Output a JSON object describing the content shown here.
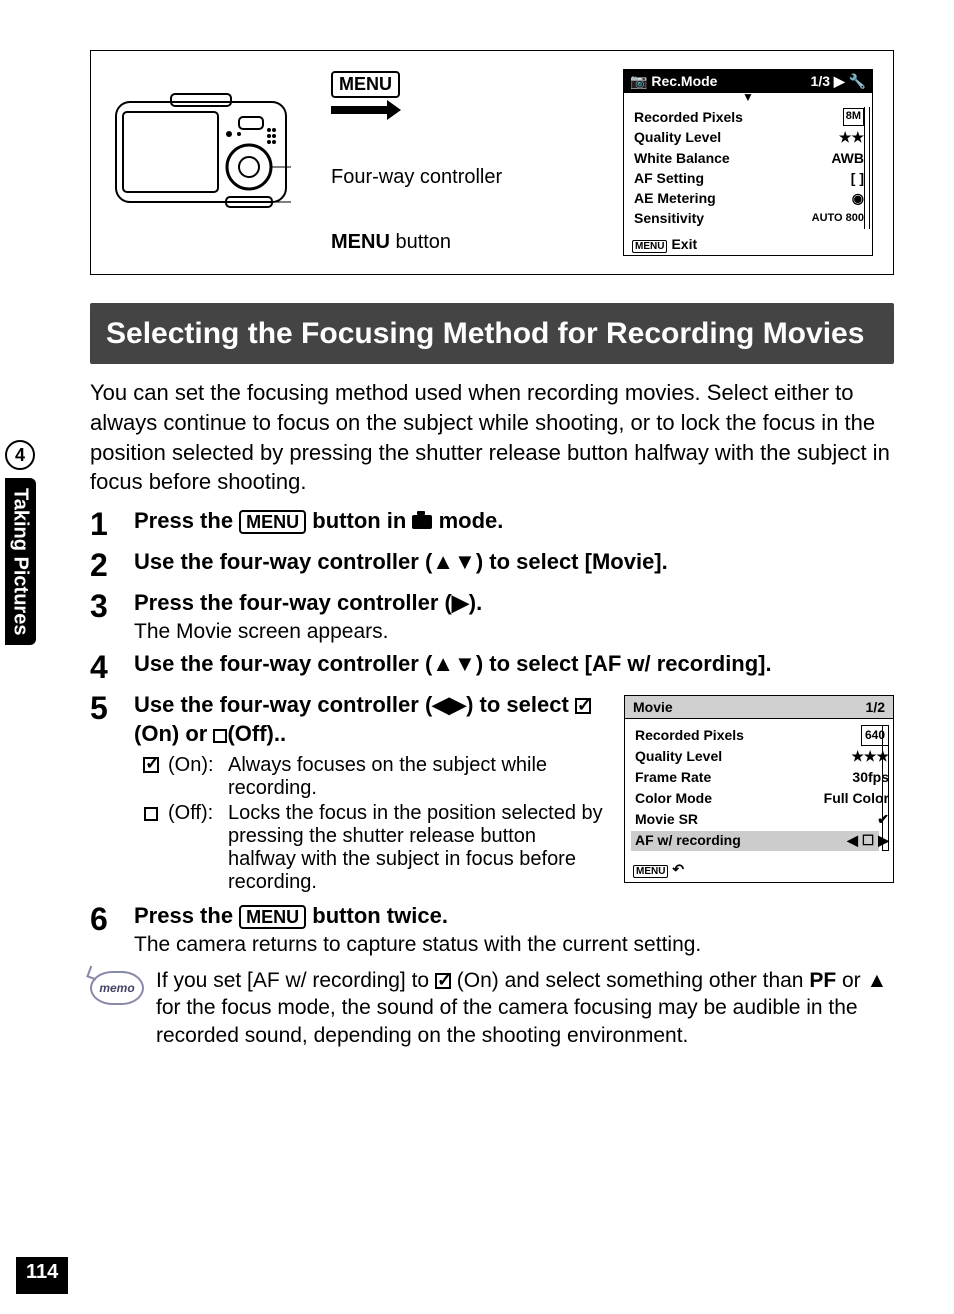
{
  "side": {
    "chapter_num": "4",
    "chapter_label": "Taking Pictures"
  },
  "page_number": "114",
  "figure": {
    "controller_label": "Four-way controller",
    "menu_button_label_prefix": "MENU",
    "menu_button_label_suffix": " button",
    "menu_box": "MENU"
  },
  "lcd1": {
    "title": "Rec.Mode",
    "page": "1/3",
    "rows": [
      {
        "label": "Recorded Pixels",
        "value": "8M"
      },
      {
        "label": "Quality Level",
        "value": "★★"
      },
      {
        "label": "White Balance",
        "value": "AWB"
      },
      {
        "label": "AF Setting",
        "value": "[ ]"
      },
      {
        "label": "AE Metering",
        "value": "◉"
      },
      {
        "label": "Sensitivity",
        "value": "AUTO 800"
      }
    ],
    "exit": "Exit"
  },
  "section_title": "Selecting the Focusing Method for Recording Movies",
  "intro": "You can set the focusing method used when recording movies. Select either to always continue to focus on the subject while shooting, or to lock the focus in the position selected by pressing the shutter release button halfway with the subject in focus before shooting.",
  "steps": {
    "s1_a": "Press the ",
    "s1_b": " button in ",
    "s1_c": " mode.",
    "s2": "Use the four-way controller (▲▼) to select [Movie].",
    "s3": "Press the four-way controller (▶).",
    "s3_sub": "The Movie screen appears.",
    "s4": "Use the four-way controller (▲▼) to select [AF w/ recording].",
    "s5_a": "Use the four-way controller (◀▶) to select ",
    "s5_on": " (On) or ",
    "s5_off": "(Off)..",
    "opt_on_label": "(On):",
    "opt_on_desc": "Always focuses on the subject while recording.",
    "opt_off_label": "(Off):",
    "opt_off_desc": "Locks the focus in the position selected by pressing the shutter release button halfway with the subject in focus before recording.",
    "s6_a": "Press the ",
    "s6_b": " button twice.",
    "s6_sub": "The camera returns to capture status with the current setting."
  },
  "lcd2": {
    "title": "Movie",
    "page": "1/2",
    "rows": [
      {
        "label": "Recorded Pixels",
        "value": "640"
      },
      {
        "label": "Quality Level",
        "value": "★★★"
      },
      {
        "label": "Frame Rate",
        "value": "30fps"
      },
      {
        "label": "Color Mode",
        "value": "Full Color"
      },
      {
        "label": "Movie SR",
        "value": "✔"
      },
      {
        "label": "AF w/ recording",
        "value": "◀ ☐        ▶"
      }
    ]
  },
  "memo": {
    "label": "memo",
    "text_a": "If you set [AF w/ recording] to ",
    "text_b": " (On) and select something other than ",
    "pf": "PF",
    "text_c": " or ",
    "mountain": "▲",
    "text_d": " for the focus mode, the sound of the camera focusing may be audible in the recorded sound, depending on the shooting environment."
  }
}
